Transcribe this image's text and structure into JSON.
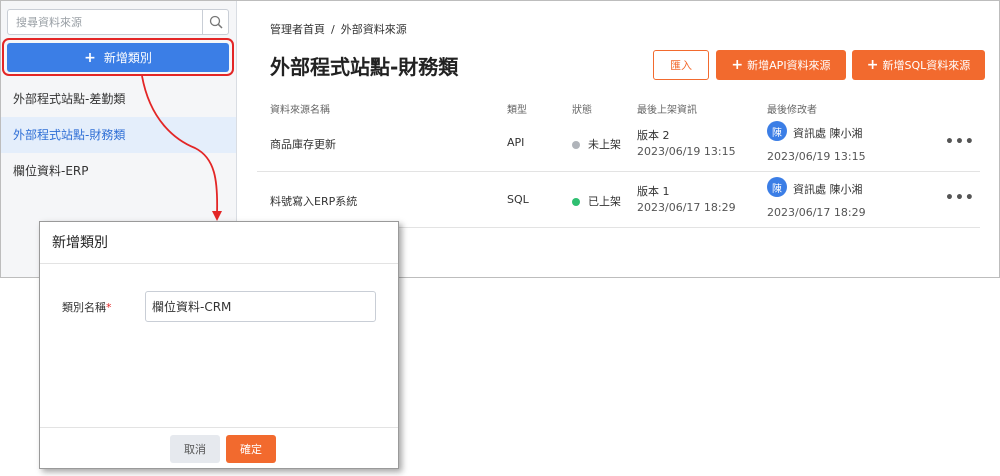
{
  "sidebar": {
    "search_placeholder": "搜尋資料來源",
    "add_category_label": "新增類別",
    "items": [
      {
        "label": "外部程式站點-差勤類"
      },
      {
        "label": "外部程式站點-財務類"
      },
      {
        "label": "欄位資料-ERP"
      }
    ]
  },
  "breadcrumb": {
    "home": "管理者首頁",
    "separator": "/",
    "current": "外部資料來源"
  },
  "page_title": "外部程式站點-財務類",
  "buttons": {
    "import": "匯入",
    "add_api": "新增API資料來源",
    "add_sql": "新增SQL資料來源"
  },
  "table": {
    "headers": {
      "name": "資料來源名稱",
      "type": "類型",
      "status": "狀態",
      "last_release": "最後上架資訊",
      "last_editor": "最後修改者"
    },
    "rows": [
      {
        "name": "商品庫存更新",
        "type": "API",
        "status": "未上架",
        "status_color": "#b0b4ba",
        "version": "版本 2",
        "release_time": "2023/06/19 13:15",
        "avatar": "陳",
        "editor": "資訊處 陳小湘",
        "edit_time": "2023/06/19 13:15",
        "more": "•••"
      },
      {
        "name": "料號寫入ERP系統",
        "type": "SQL",
        "status": "已上架",
        "status_color": "#2fbf71",
        "version": "版本 1",
        "release_time": "2023/06/17 18:29",
        "avatar": "陳",
        "editor": "資訊處 陳小湘",
        "edit_time": "2023/06/17 18:29",
        "more": "•••"
      }
    ]
  },
  "dialog": {
    "title": "新增類別",
    "field_label": "類別名稱",
    "required_mark": "*",
    "field_value": "欄位資料-CRM",
    "cancel": "取消",
    "confirm": "確定"
  },
  "colors": {
    "primary": "#3b7ee6",
    "accent": "#f26a2e",
    "highlight": "#e32626"
  }
}
